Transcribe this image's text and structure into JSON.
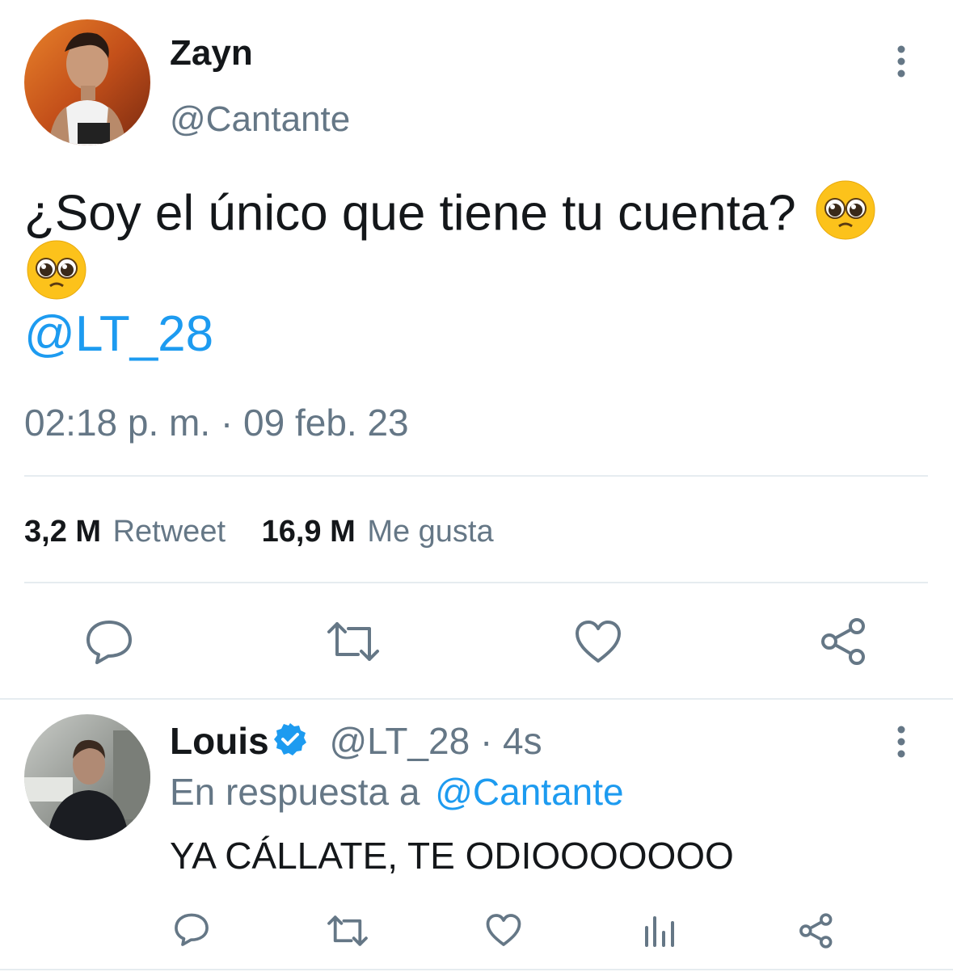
{
  "tweet": {
    "display_name": "Zayn",
    "handle": "@Cantante",
    "text": "¿Soy el único que tiene tu cuenta?",
    "emoji_icon": "pleading-face-emoji",
    "mention": "@LT_28",
    "timestamp": "02:18 p. m. · 09 feb. 23",
    "stats": {
      "retweets_count": "3,2 M",
      "retweets_label": "Retweet",
      "likes_count": "16,9 M",
      "likes_label": "Me gusta"
    },
    "actions": [
      "reply-icon",
      "retweet-icon",
      "like-icon",
      "share-icon"
    ]
  },
  "reply": {
    "display_name": "Louis",
    "verified_icon": "verified-badge-icon",
    "handle_time": "@LT_28 · 4s",
    "reply_prefix": "En respuesta a",
    "reply_to": "@Cantante",
    "text": "YA CÁLLATE, TE ODIOOOOOOO",
    "actions": [
      "reply-icon",
      "retweet-icon",
      "like-icon",
      "analytics-icon",
      "share-icon"
    ]
  },
  "colors": {
    "link": "#1d9bf0",
    "muted": "#657786",
    "divider": "#e6ecf0",
    "text": "#14171a"
  }
}
